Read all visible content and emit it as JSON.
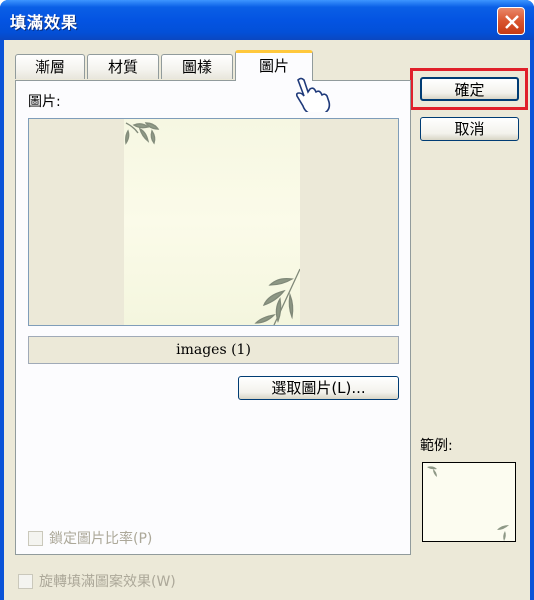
{
  "window": {
    "title": "填滿效果"
  },
  "tabs": [
    {
      "label": "漸層"
    },
    {
      "label": "材質"
    },
    {
      "label": "圖樣"
    },
    {
      "label": "圖片"
    }
  ],
  "panel": {
    "picture_label": "圖片:",
    "filename": "images (1)",
    "select_picture_button": "選取圖片(L)...",
    "lock_aspect_checkbox": "鎖定圖片比率(P)"
  },
  "buttons": {
    "ok": "確定",
    "cancel": "取消"
  },
  "sample": {
    "label": "範例:"
  },
  "rotate_checkbox": "旋轉填滿圖案效果(W)",
  "icons": [
    "close-icon",
    "hand-cursor-icon"
  ],
  "colors": {
    "titlebar": "#0454e2",
    "dialog_bg": "#ece9d8",
    "active_tab_accent": "#ffc83c",
    "highlight_border": "#e0202a"
  }
}
